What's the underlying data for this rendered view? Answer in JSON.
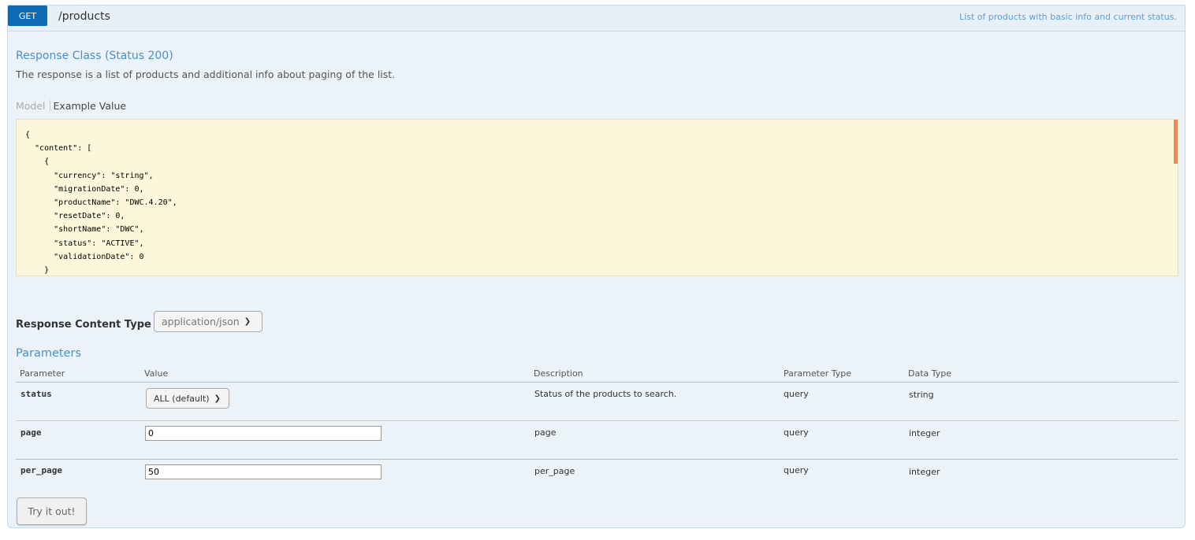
{
  "operation": {
    "method": "GET",
    "path": "/products",
    "summary": "List of products with basic info and current status."
  },
  "response_class": {
    "title": "Response Class (Status 200)",
    "description": "The response is a list of products and additional info about paging of the list.",
    "tabs": {
      "model": "Model",
      "example": "Example Value"
    },
    "example_json": "{\n  \"content\": [\n    {\n      \"currency\": \"string\",\n      \"migrationDate\": 0,\n      \"productName\": \"DWC.4.20\",\n      \"resetDate\": 0,\n      \"shortName\": \"DWC\",\n      \"status\": \"ACTIVE\",\n      \"validationDate\": 0\n    }"
  },
  "response_content_type": {
    "label": "Response Content Type",
    "selected": "application/json"
  },
  "parameters": {
    "title": "Parameters",
    "headers": [
      "Parameter",
      "Value",
      "Description",
      "Parameter Type",
      "Data Type"
    ],
    "rows": [
      {
        "name": "status",
        "value": "ALL (default)",
        "description": "Status of the products to search.",
        "param_type": "query",
        "data_type": "string"
      },
      {
        "name": "page",
        "value": "0",
        "description": "page",
        "param_type": "query",
        "data_type": "integer"
      },
      {
        "name": "per_page",
        "value": "50",
        "description": "per_page",
        "param_type": "query",
        "data_type": "integer"
      }
    ]
  },
  "try_button": "Try it out!",
  "colors": {
    "method_get": "#0f6ab4",
    "panel_bg": "#ebf3f9",
    "link_blue": "#4a90c8",
    "snippet_bg": "#fcf6db"
  }
}
